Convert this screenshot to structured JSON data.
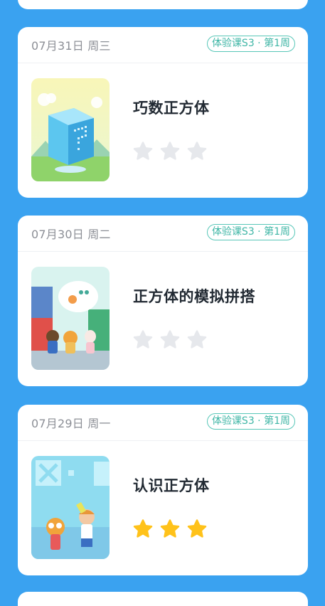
{
  "lessons": [
    {
      "date": "07月31日 周三",
      "badge": "体验课S3 · 第1周",
      "title": "巧数正方体",
      "stars_earned": 0,
      "stars_total": 3
    },
    {
      "date": "07月30日 周二",
      "badge": "体验课S3 · 第1周",
      "title": "正方体的模拟拼搭",
      "stars_earned": 0,
      "stars_total": 3
    },
    {
      "date": "07月29日 周一",
      "badge": "体验课S3 · 第1周",
      "title": "认识正方体",
      "stars_earned": 3,
      "stars_total": 3
    }
  ],
  "colors": {
    "background": "#3aa2f0",
    "card": "#ffffff",
    "badge": "#3fb6a6",
    "star_filled": "#ffc21a",
    "star_empty": "#e6e8ec",
    "title": "#222a33",
    "date": "#8c8f96"
  },
  "icons": {
    "star": "star-icon"
  }
}
